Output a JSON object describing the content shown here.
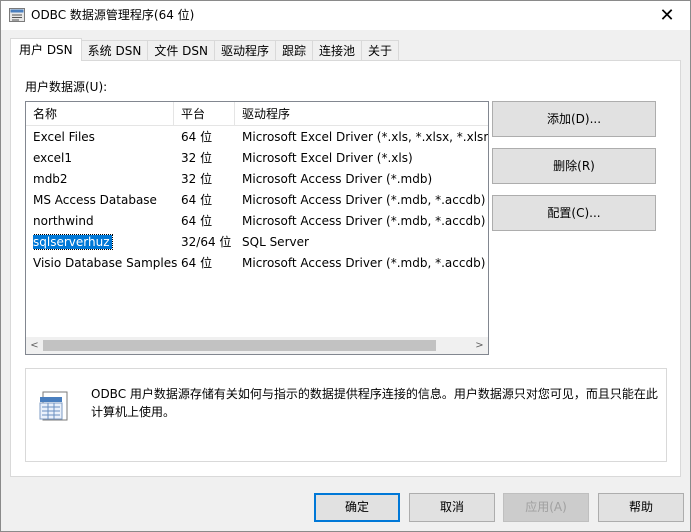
{
  "window": {
    "title": "ODBC 数据源管理程序(64 位)",
    "close_glyph": "✕"
  },
  "tabs": [
    {
      "label": "用户 DSN",
      "active": true
    },
    {
      "label": "系统 DSN"
    },
    {
      "label": "文件 DSN"
    },
    {
      "label": "驱动程序"
    },
    {
      "label": "跟踪"
    },
    {
      "label": "连接池"
    },
    {
      "label": "关于"
    }
  ],
  "panel": {
    "list_label": "用户数据源(U):",
    "columns": {
      "name": "名称",
      "platform": "平台",
      "driver": "驱动程序"
    },
    "rows": [
      {
        "name": "Excel Files",
        "platform": "64 位",
        "driver": "Microsoft Excel Driver (*.xls, *.xlsx, *.xlsm, *"
      },
      {
        "name": "excel1",
        "platform": "32 位",
        "driver": "Microsoft Excel Driver (*.xls)"
      },
      {
        "name": "mdb2",
        "platform": "32 位",
        "driver": "Microsoft Access Driver (*.mdb)"
      },
      {
        "name": "MS Access Database",
        "platform": "64 位",
        "driver": "Microsoft Access Driver (*.mdb, *.accdb)"
      },
      {
        "name": "northwind",
        "platform": "64 位",
        "driver": "Microsoft Access Driver (*.mdb, *.accdb)"
      },
      {
        "name": "sqlserverhuz",
        "platform": "32/64 位",
        "driver": "SQL Server",
        "selected": true
      },
      {
        "name": "Visio Database Samples",
        "platform": "64 位",
        "driver": "Microsoft Access Driver (*.mdb, *.accdb)"
      }
    ],
    "scroll_left": "<",
    "scroll_right": ">"
  },
  "side_buttons": {
    "add": "添加(D)...",
    "remove": "删除(R)",
    "configure": "配置(C)..."
  },
  "info": {
    "text": "ODBC 用户数据源存储有关如何与指示的数据提供程序连接的信息。用户数据源只对您可见，而且只能在此计算机上使用。",
    "icon": "odbc-datasource-icon"
  },
  "bottom_buttons": {
    "ok": "确定",
    "cancel": "取消",
    "apply": "应用(A)",
    "help": "帮助"
  },
  "colors": {
    "selection": "#0078d7",
    "default_button_border": "#0078d7"
  }
}
